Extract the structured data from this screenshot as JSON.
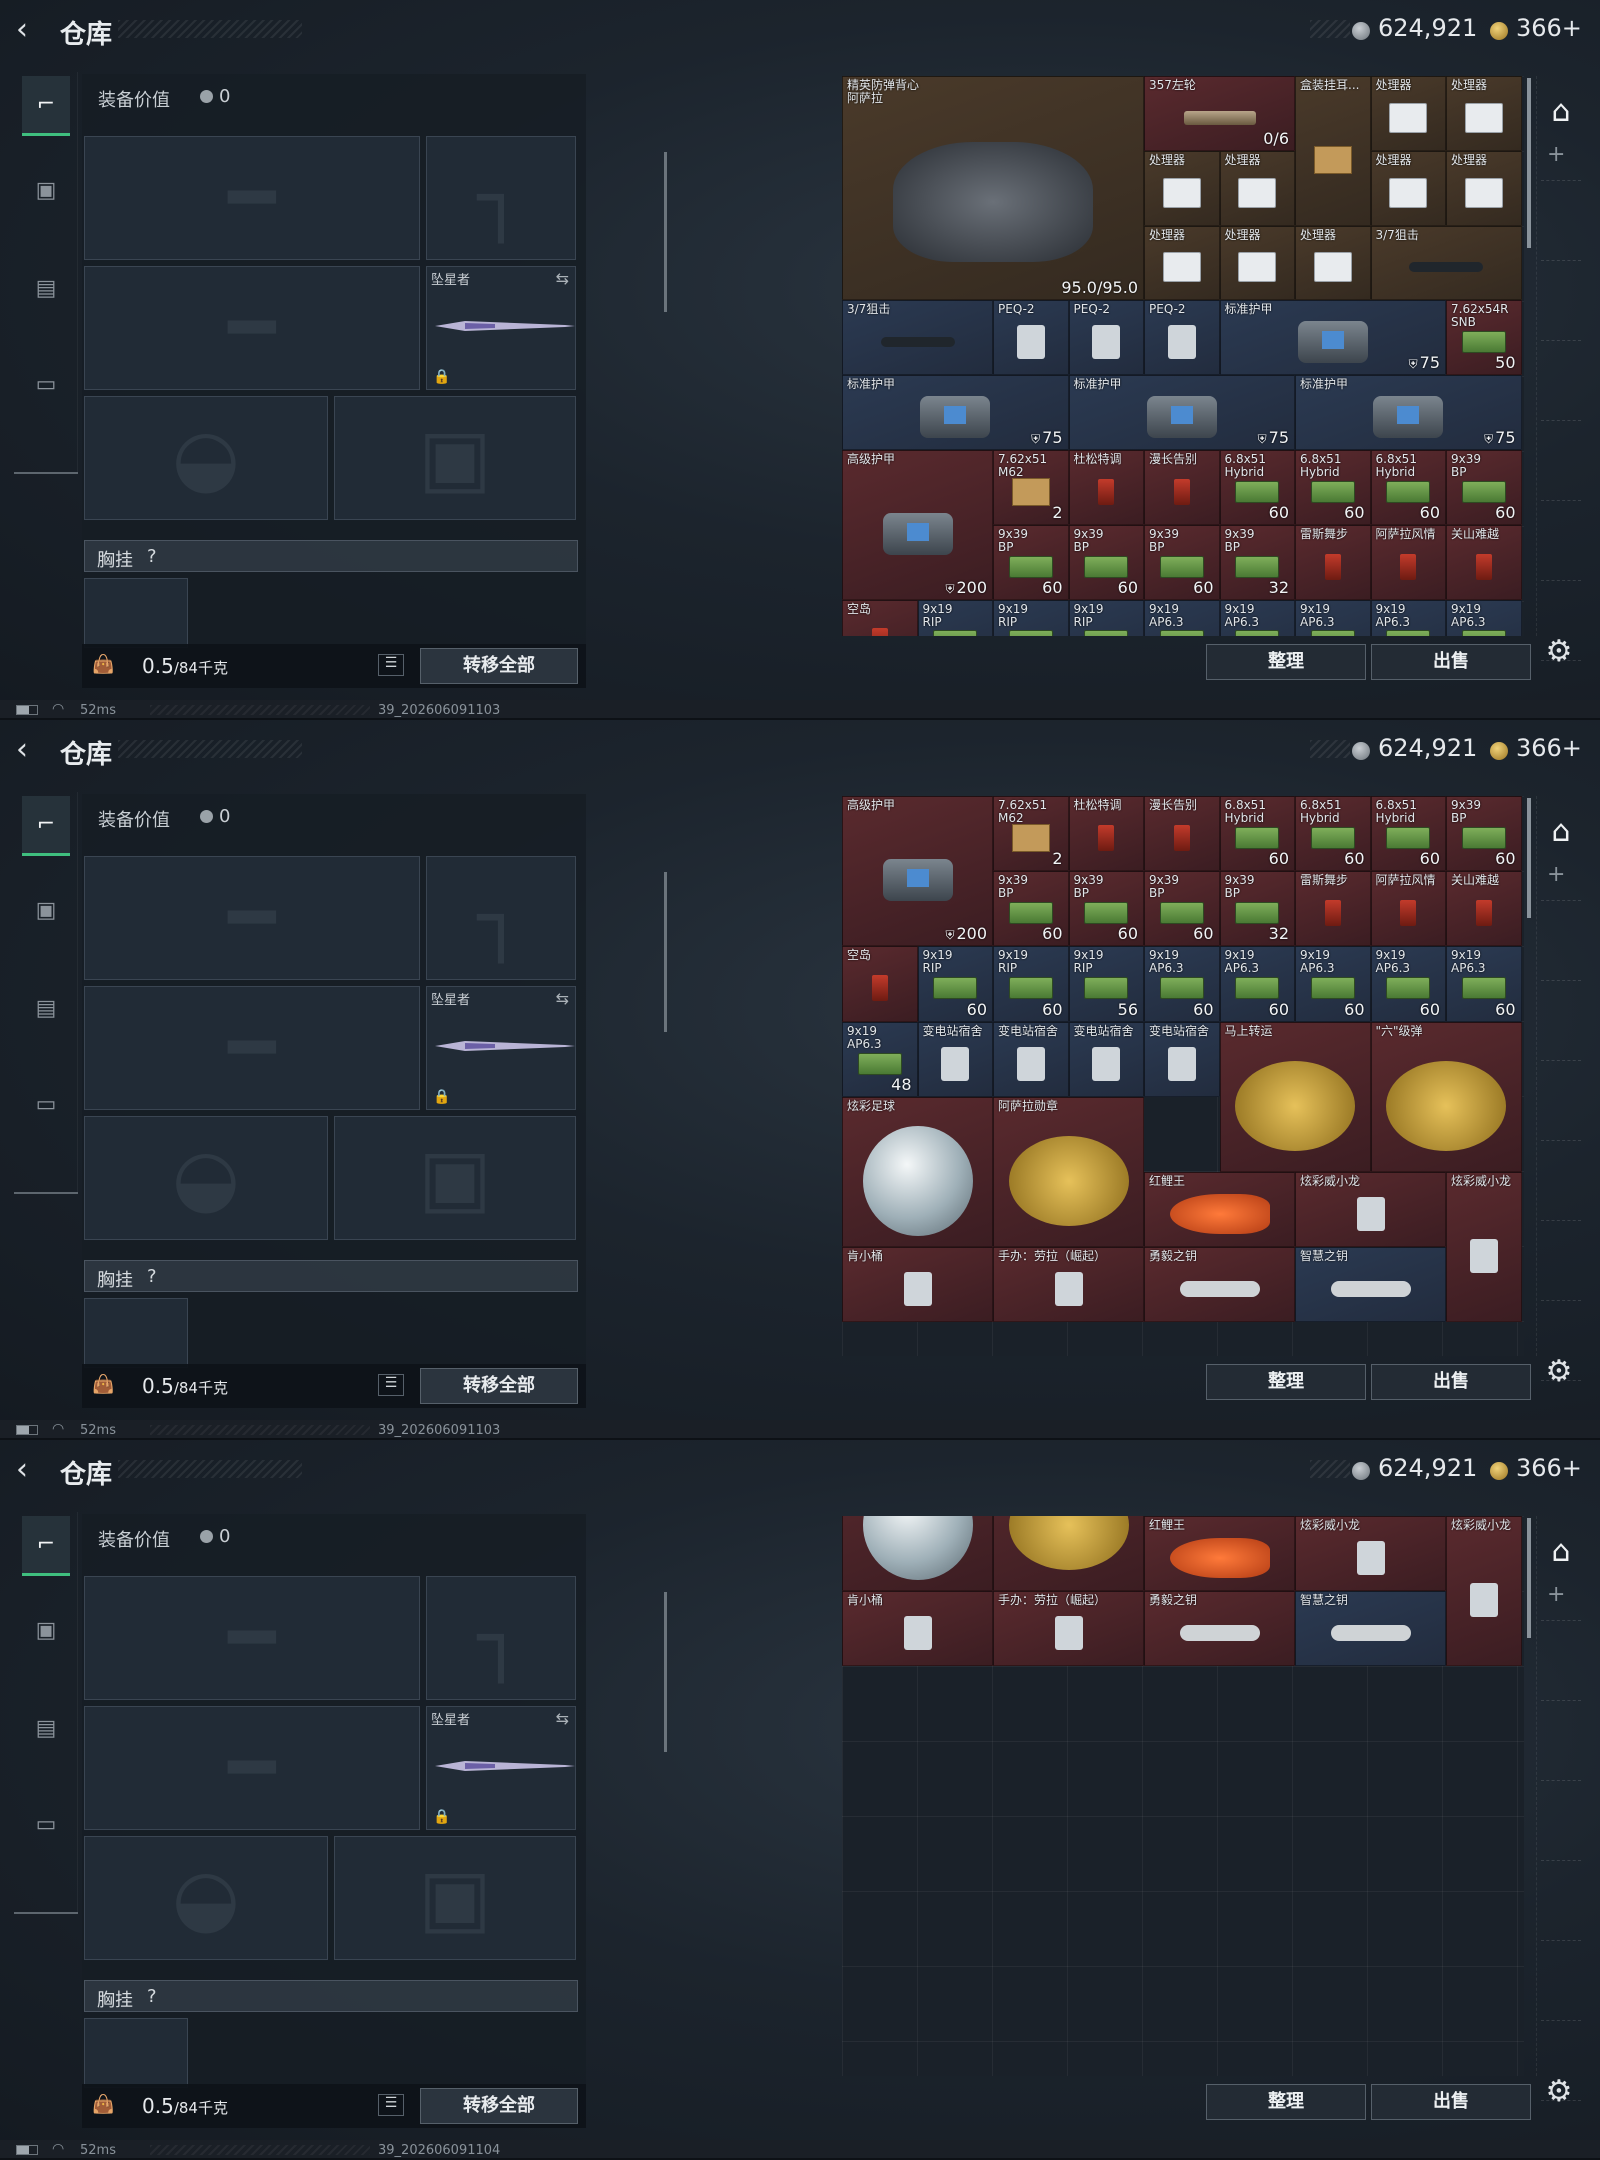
{
  "screens": [
    {
      "title": "仓库",
      "currency1": "624,921",
      "currency2": "366+",
      "equip_label": "装备价值",
      "equip_value": "0",
      "melee_name": "坠星者",
      "rig_label": "胸挂",
      "rig_help": "?",
      "weight_main": "0.5",
      "weight_unit": "/84千克",
      "transfer_label": "转移全部",
      "sort_label": "整理",
      "sell_label": "出售",
      "ping": "52ms",
      "build": "39_202606091103"
    },
    {
      "title": "仓库",
      "currency1": "624,921",
      "currency2": "366+",
      "equip_label": "装备价值",
      "equip_value": "0",
      "melee_name": "坠星者",
      "rig_label": "胸挂",
      "rig_help": "?",
      "weight_main": "0.5",
      "weight_unit": "/84千克",
      "transfer_label": "转移全部",
      "sort_label": "整理",
      "sell_label": "出售",
      "ping": "52ms",
      "build": "39_202606091103"
    },
    {
      "title": "仓库",
      "currency1": "624,921",
      "currency2": "366+",
      "equip_label": "装备价值",
      "equip_value": "0",
      "melee_name": "坠星者",
      "rig_label": "胸挂",
      "rig_help": "?",
      "weight_main": "0.5",
      "weight_unit": "/84千克",
      "transfer_label": "转移全部",
      "sort_label": "整理",
      "sell_label": "出售",
      "ping": "52ms",
      "build": "39_202606091104"
    }
  ],
  "grid1": [
    {
      "name": "精英防弹背心\n阿萨拉",
      "val": "95.0/95.0",
      "c": "amber",
      "col": 0,
      "row": 0,
      "w": 4,
      "h": 3,
      "t": "vest"
    },
    {
      "name": "357左轮",
      "val": "0/6",
      "c": "red",
      "col": 4,
      "row": 0,
      "w": 2,
      "h": 1,
      "t": "gun"
    },
    {
      "name": "盒装挂耳...",
      "val": "",
      "c": "amber",
      "col": 6,
      "row": 0,
      "w": 1,
      "h": 2,
      "t": "box"
    },
    {
      "name": "处理器",
      "val": "",
      "c": "amber",
      "col": 7,
      "row": 0,
      "w": 1,
      "h": 1,
      "t": "proc"
    },
    {
      "name": "处理器",
      "val": "",
      "c": "amber",
      "col": 8,
      "row": 0,
      "w": 1,
      "h": 1,
      "t": "proc"
    },
    {
      "name": "处理器",
      "val": "",
      "c": "amber",
      "col": 4,
      "row": 1,
      "w": 1,
      "h": 1,
      "t": "proc"
    },
    {
      "name": "处理器",
      "val": "",
      "c": "amber",
      "col": 5,
      "row": 1,
      "w": 1,
      "h": 1,
      "t": "proc"
    },
    {
      "name": "处理器",
      "val": "",
      "c": "amber",
      "col": 7,
      "row": 1,
      "w": 1,
      "h": 1,
      "t": "proc"
    },
    {
      "name": "处理器",
      "val": "",
      "c": "amber",
      "col": 8,
      "row": 1,
      "w": 1,
      "h": 1,
      "t": "proc"
    },
    {
      "name": "处理器",
      "val": "",
      "c": "amber",
      "col": 4,
      "row": 2,
      "w": 1,
      "h": 1,
      "t": "proc"
    },
    {
      "name": "处理器",
      "val": "",
      "c": "amber",
      "col": 5,
      "row": 2,
      "w": 1,
      "h": 1,
      "t": "proc"
    },
    {
      "name": "处理器",
      "val": "",
      "c": "amber",
      "col": 6,
      "row": 2,
      "w": 1,
      "h": 1,
      "t": "proc"
    },
    {
      "name": "3/7狙击",
      "val": "",
      "c": "amber",
      "col": 7,
      "row": 2,
      "w": 2,
      "h": 1,
      "t": "scope"
    },
    {
      "name": "3/7狙击",
      "val": "",
      "c": "blue",
      "col": 0,
      "row": 3,
      "w": 2,
      "h": 1,
      "t": "scope"
    },
    {
      "name": "PEQ-2",
      "val": "",
      "c": "blue",
      "col": 2,
      "row": 3,
      "w": 1,
      "h": 1,
      "t": "small"
    },
    {
      "name": "PEQ-2",
      "val": "",
      "c": "blue",
      "col": 3,
      "row": 3,
      "w": 1,
      "h": 1,
      "t": "small"
    },
    {
      "name": "PEQ-2",
      "val": "",
      "c": "blue",
      "col": 4,
      "row": 3,
      "w": 1,
      "h": 1,
      "t": "small"
    },
    {
      "name": "标准护甲",
      "val": "75",
      "c": "blue",
      "col": 5,
      "row": 3,
      "w": 3,
      "h": 1,
      "t": "bag",
      "shield": true
    },
    {
      "name": "7.62x54R\nSNB",
      "val": "50",
      "c": "red",
      "col": 8,
      "row": 3,
      "w": 1,
      "h": 1,
      "t": "ammo"
    },
    {
      "name": "标准护甲",
      "val": "75",
      "c": "blue",
      "col": 0,
      "row": 4,
      "w": 3,
      "h": 1,
      "t": "bag",
      "shield": true
    },
    {
      "name": "标准护甲",
      "val": "75",
      "c": "blue",
      "col": 3,
      "row": 4,
      "w": 3,
      "h": 1,
      "t": "bag",
      "shield": true
    },
    {
      "name": "标准护甲",
      "val": "75",
      "c": "blue",
      "col": 6,
      "row": 4,
      "w": 3,
      "h": 1,
      "t": "bag",
      "shield": true
    },
    {
      "name": "高级护甲",
      "val": "200",
      "c": "red",
      "col": 0,
      "row": 5,
      "w": 2,
      "h": 2,
      "t": "bag",
      "shield": true
    },
    {
      "name": "7.62x51\nM62",
      "val": "2",
      "c": "red",
      "col": 2,
      "row": 5,
      "w": 1,
      "h": 1,
      "t": "box"
    },
    {
      "name": "杜松特调",
      "val": "",
      "c": "red",
      "col": 3,
      "row": 5,
      "w": 1,
      "h": 1,
      "t": "drink"
    },
    {
      "name": "漫长告别",
      "val": "",
      "c": "red",
      "col": 4,
      "row": 5,
      "w": 1,
      "h": 1,
      "t": "drink"
    },
    {
      "name": "6.8x51\nHybrid",
      "val": "60",
      "c": "red",
      "col": 5,
      "row": 5,
      "w": 1,
      "h": 1,
      "t": "ammo"
    },
    {
      "name": "6.8x51\nHybrid",
      "val": "60",
      "c": "red",
      "col": 6,
      "row": 5,
      "w": 1,
      "h": 1,
      "t": "ammo"
    },
    {
      "name": "6.8x51\nHybrid",
      "val": "60",
      "c": "red",
      "col": 7,
      "row": 5,
      "w": 1,
      "h": 1,
      "t": "ammo"
    },
    {
      "name": "9x39\nBP",
      "val": "60",
      "c": "red",
      "col": 8,
      "row": 5,
      "w": 1,
      "h": 1,
      "t": "ammo"
    },
    {
      "name": "9x39\nBP",
      "val": "60",
      "c": "red",
      "col": 2,
      "row": 6,
      "w": 1,
      "h": 1,
      "t": "ammo"
    },
    {
      "name": "9x39\nBP",
      "val": "60",
      "c": "red",
      "col": 3,
      "row": 6,
      "w": 1,
      "h": 1,
      "t": "ammo"
    },
    {
      "name": "9x39\nBP",
      "val": "60",
      "c": "red",
      "col": 4,
      "row": 6,
      "w": 1,
      "h": 1,
      "t": "ammo"
    },
    {
      "name": "9x39\nBP",
      "val": "32",
      "c": "red",
      "col": 5,
      "row": 6,
      "w": 1,
      "h": 1,
      "t": "ammo"
    },
    {
      "name": "雷斯舞步",
      "val": "",
      "c": "red",
      "col": 6,
      "row": 6,
      "w": 1,
      "h": 1,
      "t": "drink"
    },
    {
      "name": "阿萨拉风情",
      "val": "",
      "c": "red",
      "col": 7,
      "row": 6,
      "w": 1,
      "h": 1,
      "t": "drink"
    },
    {
      "name": "关山难越",
      "val": "",
      "c": "red",
      "col": 8,
      "row": 6,
      "w": 1,
      "h": 1,
      "t": "drink"
    },
    {
      "name": "空岛",
      "val": "",
      "c": "red",
      "col": 0,
      "row": 7,
      "w": 1,
      "h": 1,
      "t": "drink"
    },
    {
      "name": "9x19\nRIP",
      "val": "",
      "c": "blue",
      "col": 1,
      "row": 7,
      "w": 1,
      "h": 1,
      "t": "ammo"
    },
    {
      "name": "9x19\nRIP",
      "val": "",
      "c": "blue",
      "col": 2,
      "row": 7,
      "w": 1,
      "h": 1,
      "t": "ammo"
    },
    {
      "name": "9x19\nRIP",
      "val": "",
      "c": "blue",
      "col": 3,
      "row": 7,
      "w": 1,
      "h": 1,
      "t": "ammo"
    },
    {
      "name": "9x19\nAP6.3",
      "val": "",
      "c": "blue",
      "col": 4,
      "row": 7,
      "w": 1,
      "h": 1,
      "t": "ammo"
    },
    {
      "name": "9x19\nAP6.3",
      "val": "",
      "c": "blue",
      "col": 5,
      "row": 7,
      "w": 1,
      "h": 1,
      "t": "ammo"
    },
    {
      "name": "9x19\nAP6.3",
      "val": "",
      "c": "blue",
      "col": 6,
      "row": 7,
      "w": 1,
      "h": 1,
      "t": "ammo"
    },
    {
      "name": "9x19\nAP6.3",
      "val": "",
      "c": "blue",
      "col": 7,
      "row": 7,
      "w": 1,
      "h": 1,
      "t": "ammo"
    },
    {
      "name": "9x19\nAP6.3",
      "val": "",
      "c": "blue",
      "col": 8,
      "row": 7,
      "w": 1,
      "h": 1,
      "t": "ammo"
    }
  ],
  "grid2": [
    {
      "name": "",
      "val": "75",
      "c": "blue",
      "col": 0,
      "row": -1,
      "w": 3,
      "h": 1,
      "t": "none",
      "shield": true
    },
    {
      "name": "",
      "val": "75",
      "c": "blue",
      "col": 3,
      "row": -1,
      "w": 3,
      "h": 1,
      "t": "none",
      "shield": true
    },
    {
      "name": "",
      "val": "75",
      "c": "blue",
      "col": 6,
      "row": -1,
      "w": 3,
      "h": 1,
      "t": "none",
      "shield": true
    },
    {
      "name": "高级护甲",
      "val": "200",
      "c": "red",
      "col": 0,
      "row": 0,
      "w": 2,
      "h": 2,
      "t": "bag",
      "shield": true
    },
    {
      "name": "7.62x51\nM62",
      "val": "2",
      "c": "red",
      "col": 2,
      "row": 0,
      "w": 1,
      "h": 1,
      "t": "box"
    },
    {
      "name": "杜松特调",
      "val": "",
      "c": "red",
      "col": 3,
      "row": 0,
      "w": 1,
      "h": 1,
      "t": "drink"
    },
    {
      "name": "漫长告别",
      "val": "",
      "c": "red",
      "col": 4,
      "row": 0,
      "w": 1,
      "h": 1,
      "t": "drink"
    },
    {
      "name": "6.8x51\nHybrid",
      "val": "60",
      "c": "red",
      "col": 5,
      "row": 0,
      "w": 1,
      "h": 1,
      "t": "ammo"
    },
    {
      "name": "6.8x51\nHybrid",
      "val": "60",
      "c": "red",
      "col": 6,
      "row": 0,
      "w": 1,
      "h": 1,
      "t": "ammo"
    },
    {
      "name": "6.8x51\nHybrid",
      "val": "60",
      "c": "red",
      "col": 7,
      "row": 0,
      "w": 1,
      "h": 1,
      "t": "ammo"
    },
    {
      "name": "9x39\nBP",
      "val": "60",
      "c": "red",
      "col": 8,
      "row": 0,
      "w": 1,
      "h": 1,
      "t": "ammo"
    },
    {
      "name": "9x39\nBP",
      "val": "60",
      "c": "red",
      "col": 2,
      "row": 1,
      "w": 1,
      "h": 1,
      "t": "ammo"
    },
    {
      "name": "9x39\nBP",
      "val": "60",
      "c": "red",
      "col": 3,
      "row": 1,
      "w": 1,
      "h": 1,
      "t": "ammo"
    },
    {
      "name": "9x39\nBP",
      "val": "60",
      "c": "red",
      "col": 4,
      "row": 1,
      "w": 1,
      "h": 1,
      "t": "ammo"
    },
    {
      "name": "9x39\nBP",
      "val": "32",
      "c": "red",
      "col": 5,
      "row": 1,
      "w": 1,
      "h": 1,
      "t": "ammo"
    },
    {
      "name": "雷斯舞步",
      "val": "",
      "c": "red",
      "col": 6,
      "row": 1,
      "w": 1,
      "h": 1,
      "t": "drink"
    },
    {
      "name": "阿萨拉风情",
      "val": "",
      "c": "red",
      "col": 7,
      "row": 1,
      "w": 1,
      "h": 1,
      "t": "drink"
    },
    {
      "name": "关山难越",
      "val": "",
      "c": "red",
      "col": 8,
      "row": 1,
      "w": 1,
      "h": 1,
      "t": "drink"
    },
    {
      "name": "空岛",
      "val": "",
      "c": "red",
      "col": 0,
      "row": 2,
      "w": 1,
      "h": 1,
      "t": "drink"
    },
    {
      "name": "9x19\nRIP",
      "val": "60",
      "c": "blue",
      "col": 1,
      "row": 2,
      "w": 1,
      "h": 1,
      "t": "ammo"
    },
    {
      "name": "9x19\nRIP",
      "val": "60",
      "c": "blue",
      "col": 2,
      "row": 2,
      "w": 1,
      "h": 1,
      "t": "ammo"
    },
    {
      "name": "9x19\nRIP",
      "val": "56",
      "c": "blue",
      "col": 3,
      "row": 2,
      "w": 1,
      "h": 1,
      "t": "ammo"
    },
    {
      "name": "9x19\nAP6.3",
      "val": "60",
      "c": "blue",
      "col": 4,
      "row": 2,
      "w": 1,
      "h": 1,
      "t": "ammo"
    },
    {
      "name": "9x19\nAP6.3",
      "val": "60",
      "c": "blue",
      "col": 5,
      "row": 2,
      "w": 1,
      "h": 1,
      "t": "ammo"
    },
    {
      "name": "9x19\nAP6.3",
      "val": "60",
      "c": "blue",
      "col": 6,
      "row": 2,
      "w": 1,
      "h": 1,
      "t": "ammo"
    },
    {
      "name": "9x19\nAP6.3",
      "val": "60",
      "c": "blue",
      "col": 7,
      "row": 2,
      "w": 1,
      "h": 1,
      "t": "ammo"
    },
    {
      "name": "9x19\nAP6.3",
      "val": "60",
      "c": "blue",
      "col": 8,
      "row": 2,
      "w": 1,
      "h": 1,
      "t": "ammo"
    },
    {
      "name": "9x19\nAP6.3",
      "val": "48",
      "c": "blue",
      "col": 0,
      "row": 3,
      "w": 1,
      "h": 1,
      "t": "ammo"
    },
    {
      "name": "变电站宿舍",
      "val": "",
      "c": "blue",
      "col": 1,
      "row": 3,
      "w": 1,
      "h": 1,
      "t": "small"
    },
    {
      "name": "变电站宿舍",
      "val": "",
      "c": "blue",
      "col": 2,
      "row": 3,
      "w": 1,
      "h": 1,
      "t": "small"
    },
    {
      "name": "变电站宿舍",
      "val": "",
      "c": "blue",
      "col": 3,
      "row": 3,
      "w": 1,
      "h": 1,
      "t": "small"
    },
    {
      "name": "变电站宿舍",
      "val": "",
      "c": "blue",
      "col": 4,
      "row": 3,
      "w": 1,
      "h": 1,
      "t": "small"
    },
    {
      "name": "马上转运",
      "val": "",
      "c": "red",
      "col": 5,
      "row": 3,
      "w": 2,
      "h": 2,
      "t": "coin"
    },
    {
      "name": "\"六\"级弹",
      "val": "",
      "c": "red",
      "col": 7,
      "row": 3,
      "w": 2,
      "h": 2,
      "t": "coin"
    },
    {
      "name": "炫彩足球",
      "val": "",
      "c": "red",
      "col": 0,
      "row": 4,
      "w": 2,
      "h": 2,
      "t": "sphere"
    },
    {
      "name": "阿萨拉勋章",
      "val": "",
      "c": "red",
      "col": 2,
      "row": 4,
      "w": 2,
      "h": 2,
      "t": "coin"
    },
    {
      "name": "红鲤王",
      "val": "",
      "c": "red",
      "col": 4,
      "row": 5,
      "w": 2,
      "h": 1,
      "t": "fish"
    },
    {
      "name": "炫彩威小龙",
      "val": "",
      "c": "red",
      "col": 6,
      "row": 5,
      "w": 2,
      "h": 1,
      "t": "small"
    },
    {
      "name": "炫彩威小龙",
      "val": "",
      "c": "red",
      "col": 8,
      "row": 5,
      "w": 1,
      "h": 2,
      "t": "small"
    },
    {
      "name": "肯小桶",
      "val": "",
      "c": "red",
      "col": 0,
      "row": 6,
      "w": 2,
      "h": 1,
      "t": "small"
    },
    {
      "name": "手办：劳拉（崛起）",
      "val": "",
      "c": "red",
      "col": 2,
      "row": 6,
      "w": 2,
      "h": 1,
      "t": "small"
    },
    {
      "name": "勇毅之钥",
      "val": "",
      "c": "red",
      "col": 4,
      "row": 6,
      "w": 2,
      "h": 1,
      "t": "key"
    },
    {
      "name": "智慧之钥",
      "val": "",
      "c": "blue",
      "col": 6,
      "row": 6,
      "w": 2,
      "h": 1,
      "t": "key"
    }
  ],
  "grid3": [
    {
      "name": "",
      "val": "",
      "c": "red",
      "col": 0,
      "row": -1,
      "w": 2,
      "h": 2,
      "t": "sphere"
    },
    {
      "name": "",
      "val": "",
      "c": "red",
      "col": 2,
      "row": -1,
      "w": 2,
      "h": 2,
      "t": "coin"
    },
    {
      "name": "红鲤王",
      "val": "",
      "c": "red",
      "col": 4,
      "row": 0,
      "w": 2,
      "h": 1,
      "t": "fish"
    },
    {
      "name": "炫彩威小龙",
      "val": "",
      "c": "red",
      "col": 6,
      "row": 0,
      "w": 2,
      "h": 1,
      "t": "small"
    },
    {
      "name": "炫彩威小龙",
      "val": "",
      "c": "red",
      "col": 8,
      "row": 0,
      "w": 1,
      "h": 2,
      "t": "small"
    },
    {
      "name": "肯小桶",
      "val": "",
      "c": "red",
      "col": 0,
      "row": 1,
      "w": 2,
      "h": 1,
      "t": "small"
    },
    {
      "name": "手办：劳拉（崛起）",
      "val": "",
      "c": "red",
      "col": 2,
      "row": 1,
      "w": 2,
      "h": 1,
      "t": "small"
    },
    {
      "name": "勇毅之钥",
      "val": "",
      "c": "red",
      "col": 4,
      "row": 1,
      "w": 2,
      "h": 1,
      "t": "key"
    },
    {
      "name": "智慧之钥",
      "val": "",
      "c": "blue",
      "col": 6,
      "row": 1,
      "w": 2,
      "h": 1,
      "t": "key"
    }
  ],
  "icons": {
    "back": "back-arrow-icon",
    "tabs": [
      "weapon-tab-icon",
      "armor-tab-icon",
      "backpack-tab-icon",
      "case-tab-icon"
    ]
  }
}
